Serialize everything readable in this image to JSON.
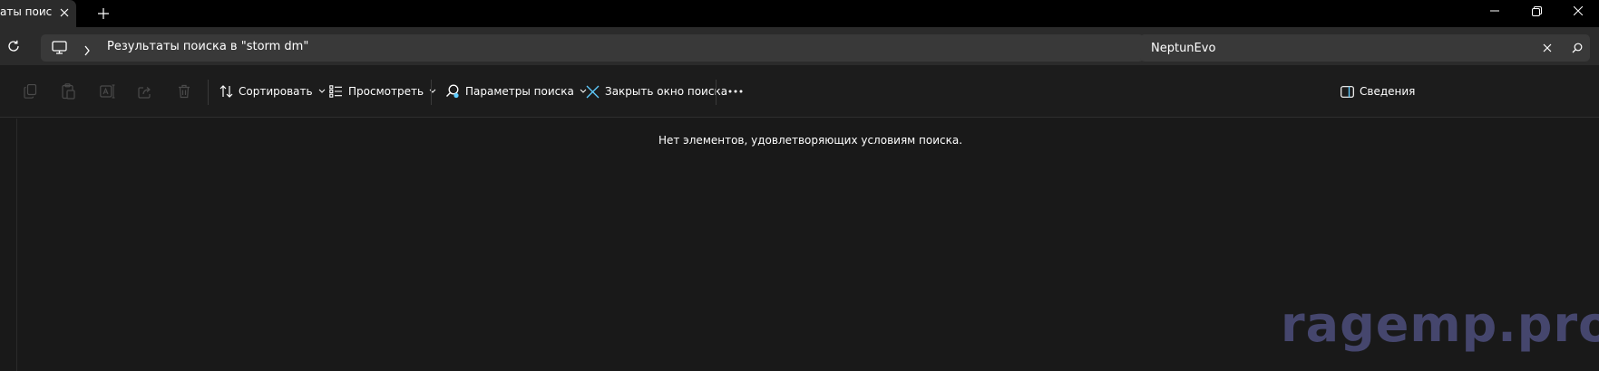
{
  "tab": {
    "title": "аты поис"
  },
  "address": {
    "path_text": "Результаты поиска в \"storm dm\""
  },
  "search": {
    "value": "NeptunEvo"
  },
  "toolbar": {
    "sort_label": "Сортировать",
    "view_label": "Просмотреть",
    "search_options_label": "Параметры поиска",
    "close_search_label": "Закрыть окно поиска",
    "details_label": "Сведения"
  },
  "content": {
    "empty_message": "Нет элементов, удовлетворяющих условиям поиска."
  },
  "watermark": {
    "text": "ragemp.pro"
  },
  "colors": {
    "accent": "#60cdff",
    "watermark": "#45466d",
    "background": "#191919"
  }
}
